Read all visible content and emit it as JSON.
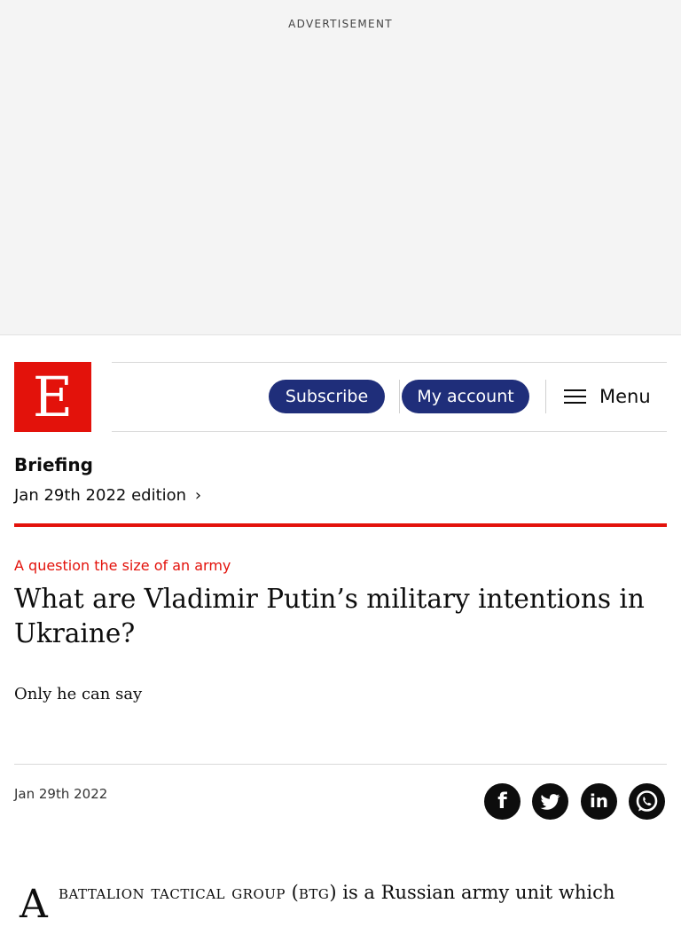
{
  "advertisement": {
    "label": "ADVERTISEMENT"
  },
  "header": {
    "logo_letter": "E",
    "subscribe_label": "Subscribe",
    "account_label": "My account",
    "menu_label": "Menu"
  },
  "section": {
    "name": "Briefing",
    "edition": "Jan 29th 2022 edition",
    "edition_chevron": "›"
  },
  "article": {
    "rubric": "A question the size of an army",
    "headline": "What are Vladimir Putin’s military intentions in Ukraine?",
    "standfirst": "Only he can say",
    "date": "Jan 29th 2022",
    "body_dropcap": "A",
    "body_smallcaps_lead": "BATTALION TACTICAL GROUP",
    "body_abbrev": "BTG",
    "body_rest": "is a Russian army unit which"
  },
  "share": {
    "facebook_glyph": "f",
    "linkedin_glyph": "in"
  },
  "colors": {
    "brand_red": "#e3120b",
    "button_navy": "#1f2e7a",
    "ad_background": "#f4f4f4"
  },
  "icons": [
    "hamburger-icon",
    "chevron-right-icon",
    "facebook-icon",
    "twitter-icon",
    "linkedin-icon",
    "whatsapp-icon"
  ]
}
